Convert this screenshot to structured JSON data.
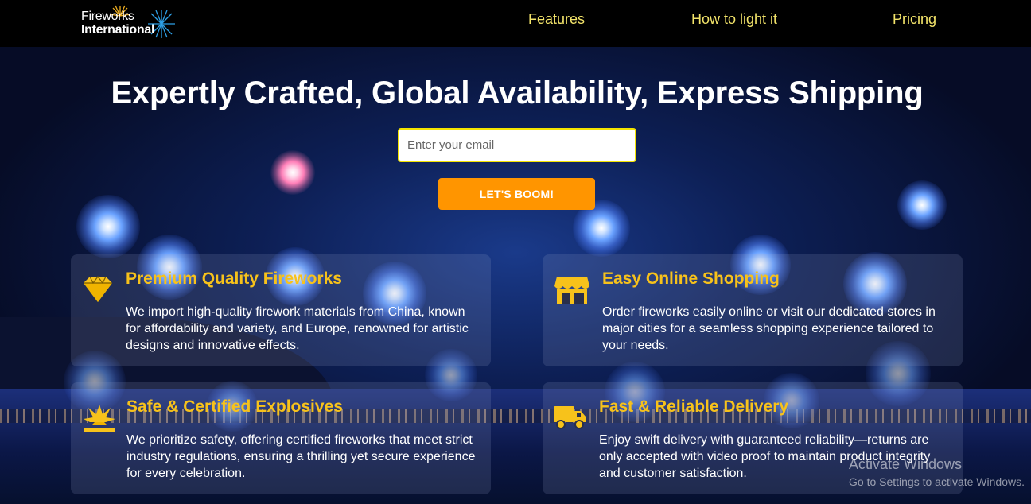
{
  "logo": {
    "line1": "Fireworks",
    "line2": "International"
  },
  "nav": {
    "items": [
      {
        "label": "Features"
      },
      {
        "label": "How to light it"
      },
      {
        "label": "Pricing"
      }
    ]
  },
  "hero": {
    "title": "Expertly Crafted, Global Availability, Express Shipping",
    "email_placeholder": "Enter your email",
    "cta_label": "LET'S BOOM!"
  },
  "features": [
    {
      "icon": "diamond-icon",
      "title": "Premium Quality Fireworks",
      "text": "We import high-quality firework materials from China, known for affordability and variety, and Europe, renowned for artistic designs and innovative effects."
    },
    {
      "icon": "store-icon",
      "title": "Easy Online Shopping",
      "text": "Order fireworks easily online or visit our dedicated stores in major cities for a seamless shopping experience tailored to your needs."
    },
    {
      "icon": "explosion-icon",
      "title": "Safe & Certified Explosives",
      "text": "We prioritize safety, offering certified fireworks that meet strict industry regulations, ensuring a thrilling yet secure experience for every celebration."
    },
    {
      "icon": "truck-icon",
      "title": "Fast & Reliable Delivery",
      "text": "Enjoy swift delivery with guaranteed reliability—returns are only accepted with video proof to maintain product integrity and customer satisfaction."
    }
  ],
  "watermark": {
    "line1": "Activate Windows",
    "line2": "Go to Settings to activate Windows."
  },
  "colors": {
    "nav_text": "#f3e46a",
    "accent": "#f7c21b",
    "cta": "#ff9500",
    "input_border": "#f5e400"
  }
}
